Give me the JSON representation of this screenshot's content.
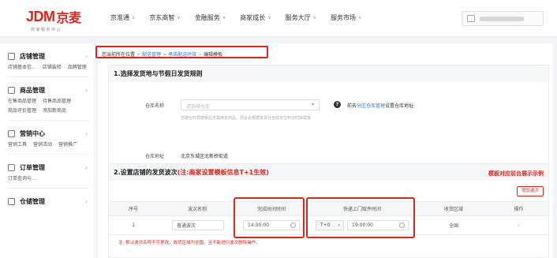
{
  "header": {
    "logo_main": "JDM",
    "logo_cn": "京麦",
    "logo_sub": "商家服务中心",
    "nav": [
      {
        "label": "京准通"
      },
      {
        "label": "京东商智"
      },
      {
        "label": "金融服务"
      },
      {
        "label": "商家成长"
      },
      {
        "label": "服务大厅"
      },
      {
        "label": "服务市场"
      }
    ]
  },
  "sidebar": {
    "groups": [
      {
        "title": "店铺管理",
        "icon": "store-icon",
        "items": [
          "店铺基本信...",
          "店铺装修",
          "品牌管理"
        ]
      },
      {
        "title": "商品管理",
        "icon": "goods-icon",
        "items": [
          "在售商品管理",
          "待售商品管理",
          "商品评价管理",
          "添加新商品"
        ]
      },
      {
        "title": "营销中心",
        "icon": "marketing-icon",
        "items": [
          "营销工具",
          "营销活动",
          "营销推广"
        ]
      },
      {
        "title": "订单管理",
        "icon": "order-icon",
        "items": [
          "订单查询与..."
        ]
      },
      {
        "title": "仓储管理",
        "icon": "warehouse-icon",
        "items": []
      }
    ]
  },
  "breadcrumb": {
    "prefix": "您当前所在位置",
    "link1": "配送管理",
    "link2": "承诺配送时效",
    "current": "编辑模板",
    "separator": ">"
  },
  "section1": {
    "title": "1.选择发货地与节假日发货规则",
    "warehouse_label": "仓库名称",
    "warehouse_placeholder": "请选择仓库",
    "hint_prefix": "前去",
    "hint_link": "分区仓库管理",
    "hint_suffix": "设置仓库地址",
    "hint_sub": "创建仓时效模板后无需绑定商品，前台会根据发货仓自动定位到仓时效模板",
    "address_label": "仓库地址",
    "address_value": "北京东城区北新桥街道"
  },
  "section2": {
    "title_main": "2.设置店铺的发货波次",
    "title_red": "(注:商家设置模板信息T+1生效)",
    "right_note": "模板对应前台展示示例",
    "add_button": "增加波次",
    "columns": [
      "序号",
      "波次名称",
      "完成时间时间",
      "快递上门取件时间",
      "收货区域",
      "操作"
    ],
    "row": {
      "index": "1",
      "name": "普通波次",
      "finish_time": "14:30:00",
      "day_offset": "T+0",
      "pickup_time": "19:00:00",
      "region": "全国",
      "action": "-"
    },
    "note": "注: 默认波次名称不可更改，收货区域为全国，且不能进行波次删除操作。"
  },
  "colors": {
    "accent": "#e1251b",
    "link": "#3a7bd5"
  }
}
